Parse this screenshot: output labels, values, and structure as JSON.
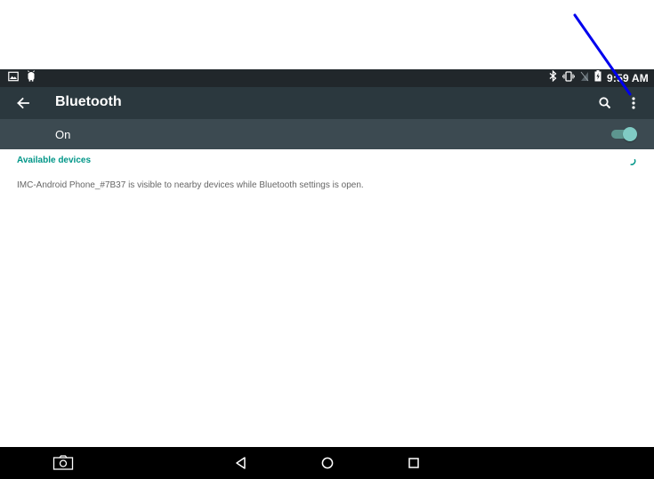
{
  "status_bar": {
    "time": "9:59 AM",
    "left_icons": [
      "image-icon",
      "android-debug-icon"
    ],
    "right_icons": [
      "bluetooth-icon",
      "vibrate-icon",
      "no-signal-icon",
      "battery-charging-icon"
    ]
  },
  "app_bar": {
    "title": "Bluetooth",
    "back_icon": "arrow-left-icon",
    "search_icon": "search-icon",
    "overflow_icon": "more-vert-icon"
  },
  "switch_bar": {
    "label": "On",
    "toggle_on": true
  },
  "content": {
    "section_header": "Available devices",
    "visibility_message": "IMC-Android Phone_#7B37 is visible to nearby devices while Bluetooth settings is open."
  },
  "nav_bar": {
    "icons": [
      "screenshot-icon",
      "back-icon",
      "home-icon",
      "recents-icon"
    ]
  },
  "colors": {
    "status_bar": "#21272b",
    "app_bar": "#2b383e",
    "switch_bar": "#3c4a51",
    "accent": "#009688",
    "toggle_thumb": "#80cbc4",
    "annotation_arrow": "#0000ee"
  }
}
